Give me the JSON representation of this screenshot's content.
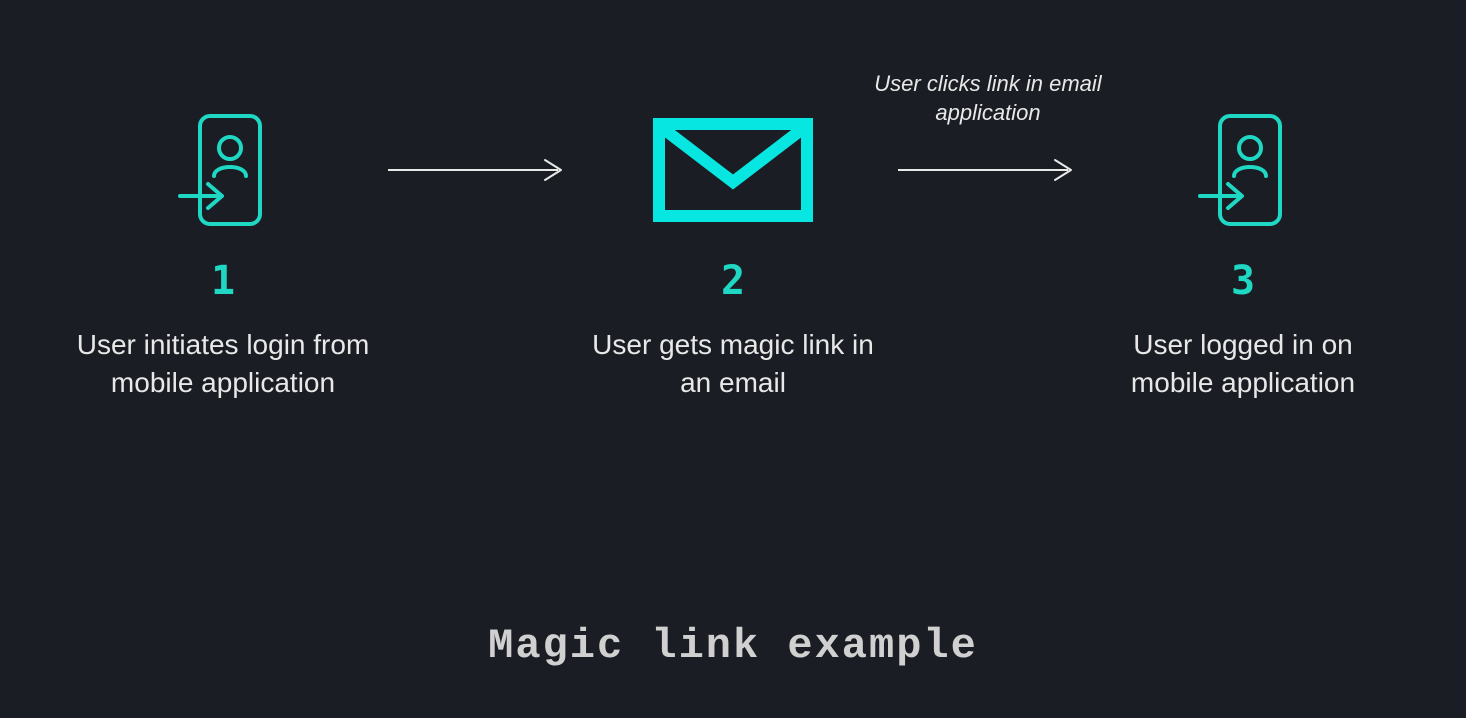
{
  "title": "Magic link example",
  "colors": {
    "accent": "#1fd8c4",
    "text": "#e8e8e8",
    "bg": "#1a1d23"
  },
  "steps": [
    {
      "number": "1",
      "description": "User initiates login from mobile application",
      "icon": "login-icon"
    },
    {
      "number": "2",
      "description": "User gets magic link in an email",
      "icon": "mail-icon"
    },
    {
      "number": "3",
      "description": "User logged in on mobile application",
      "icon": "login-icon"
    }
  ],
  "arrows": [
    {
      "label": ""
    },
    {
      "label": "User clicks link in email application"
    }
  ]
}
